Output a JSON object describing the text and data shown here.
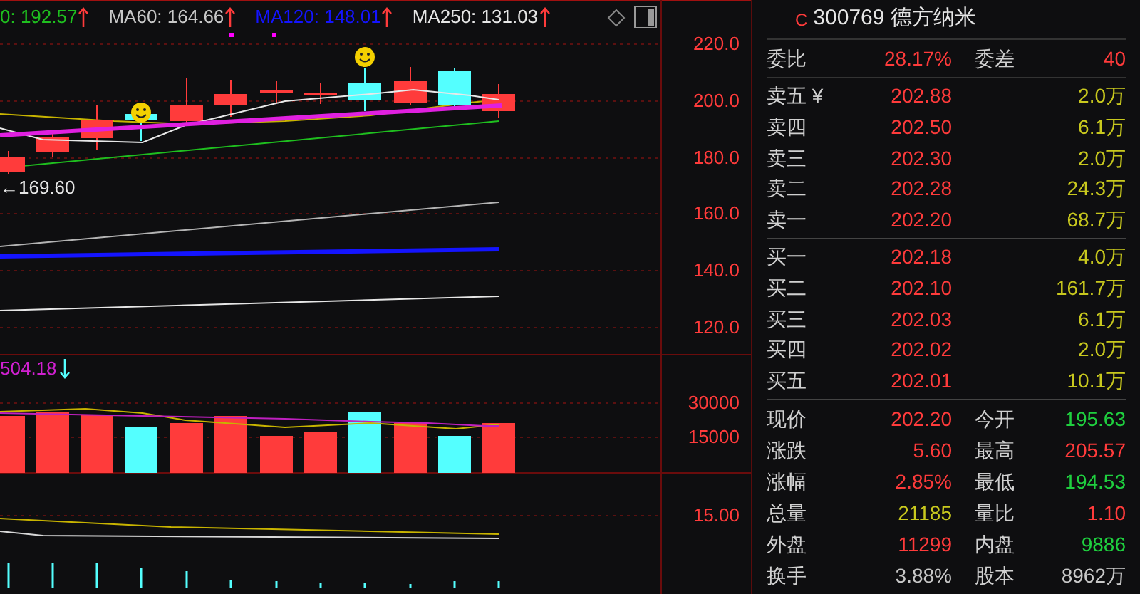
{
  "ma_legend": [
    {
      "text": "0: 192.57",
      "color": "#1fbf1f"
    },
    {
      "text": "MA60: 164.66",
      "color": "#c8c8c8"
    },
    {
      "text": "MA120: 148.01",
      "color": "#1414ff"
    },
    {
      "text": "MA250: 131.03",
      "color": "#e6e6e6"
    }
  ],
  "price_axis": [
    "220.0",
    "200.0",
    "180.0",
    "160.0",
    "140.0",
    "120.0"
  ],
  "price_marker": "←169.60",
  "volume_label": "504.18",
  "volume_axis": [
    "30000",
    "15000"
  ],
  "indicator_axis": [
    "15.00"
  ],
  "quote_header": {
    "market_letter": "C",
    "title": "300769 德方纳米"
  },
  "order_ratio": {
    "label": "委比",
    "value": "28.17%",
    "label2": "委差",
    "value2": "40"
  },
  "asks": [
    {
      "label": "卖五 ¥",
      "price": "202.88",
      "volume": "2.0万"
    },
    {
      "label": "卖四",
      "price": "202.50",
      "volume": "6.1万"
    },
    {
      "label": "卖三",
      "price": "202.30",
      "volume": "2.0万"
    },
    {
      "label": "卖二",
      "price": "202.28",
      "volume": "24.3万"
    },
    {
      "label": "卖一",
      "price": "202.20",
      "volume": "68.7万"
    }
  ],
  "bids": [
    {
      "label": "买一",
      "price": "202.18",
      "volume": "4.0万"
    },
    {
      "label": "买二",
      "price": "202.10",
      "volume": "161.7万"
    },
    {
      "label": "买三",
      "price": "202.03",
      "volume": "6.1万"
    },
    {
      "label": "买四",
      "price": "202.02",
      "volume": "2.0万"
    },
    {
      "label": "买五",
      "price": "202.01",
      "volume": "10.1万"
    }
  ],
  "stats": [
    {
      "cells": [
        {
          "label": "现价",
          "value": "202.20",
          "color": "#ff3b3b"
        },
        {
          "label": "今开",
          "value": "195.63",
          "color": "#1fcf3f"
        }
      ]
    },
    {
      "cells": [
        {
          "label": "涨跌",
          "value": "5.60",
          "color": "#ff3b3b"
        },
        {
          "label": "最高",
          "value": "205.57",
          "color": "#ff3b3b"
        }
      ]
    },
    {
      "cells": [
        {
          "label": "涨幅",
          "value": "2.85%",
          "color": "#ff3b3b"
        },
        {
          "label": "最低",
          "value": "194.53",
          "color": "#1fcf3f"
        }
      ]
    },
    {
      "cells": [
        {
          "label": "总量",
          "value": "21185",
          "color": "#c8c81e"
        },
        {
          "label": "量比",
          "value": "1.10",
          "color": "#ff3b3b"
        }
      ]
    },
    {
      "cells": [
        {
          "label": "外盘",
          "value": "11299",
          "color": "#ff3b3b"
        },
        {
          "label": "内盘",
          "value": "9886",
          "color": "#1fcf3f"
        }
      ]
    },
    {
      "cells": [
        {
          "label": "换手",
          "value": "3.88%",
          "color": "#c8c8c8"
        },
        {
          "label": "股本",
          "value": "8962万",
          "color": "#c8c8c8"
        }
      ]
    }
  ]
}
